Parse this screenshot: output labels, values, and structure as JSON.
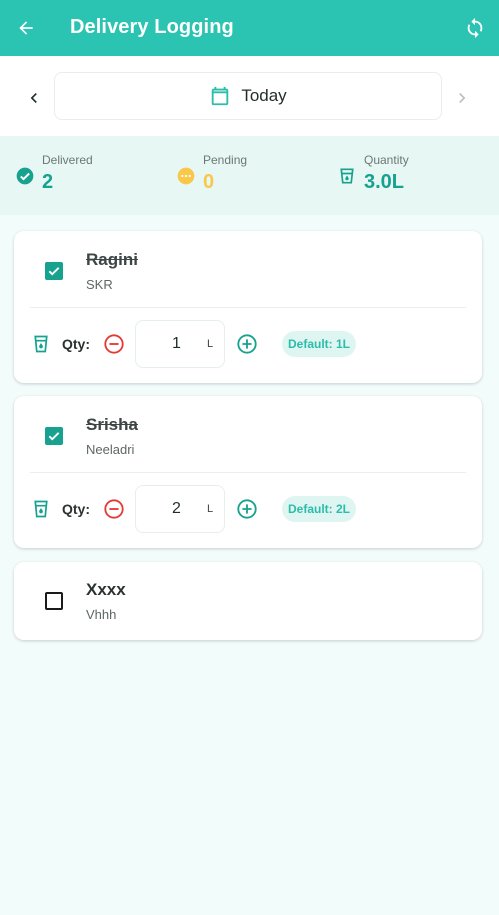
{
  "appbar": {
    "title": "Delivery Logging"
  },
  "date_nav": {
    "label": "Today"
  },
  "stats": {
    "delivered": {
      "label": "Delivered",
      "value": "2",
      "color": "#17a28f"
    },
    "pending": {
      "label": "Pending",
      "value": "0",
      "color": "#f9c84a"
    },
    "quantity": {
      "label": "Quantity",
      "value": "3.0L",
      "color": "#17a28f"
    }
  },
  "customers": [
    {
      "name": "Ragini",
      "area": "SKR",
      "delivered": true,
      "qty_label": "Qty:",
      "qty": "1",
      "unit": "L",
      "default": "Default: 1L"
    },
    {
      "name": "Srisha",
      "area": "Neeladri",
      "delivered": true,
      "qty_label": "Qty:",
      "qty": "2",
      "unit": "L",
      "default": "Default: 2L"
    },
    {
      "name": "Xxxx",
      "area": "Vhhh",
      "delivered": false
    }
  ],
  "colors": {
    "primary": "#2bc3b1",
    "accent": "#17a28f",
    "danger": "#e53935",
    "pending": "#f9c84a"
  }
}
